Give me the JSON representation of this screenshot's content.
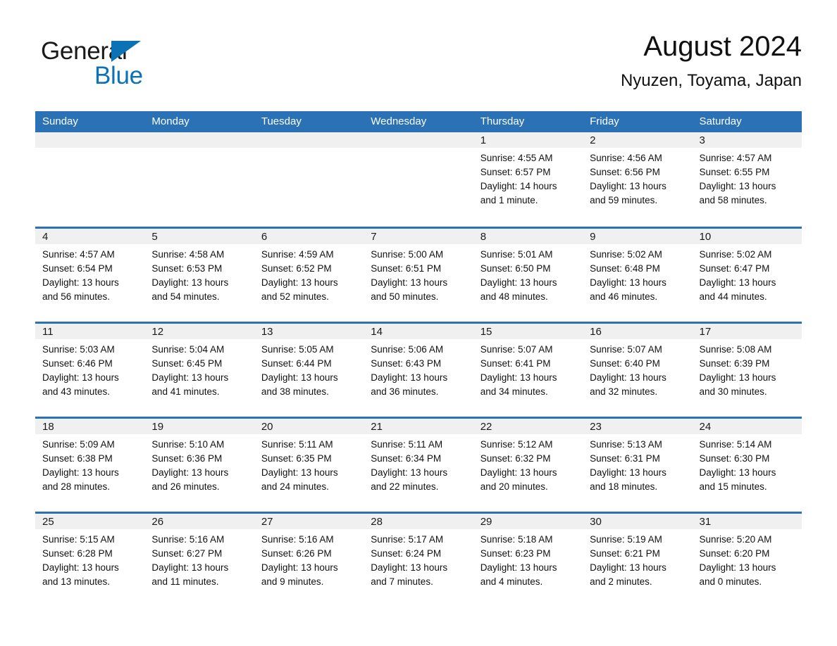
{
  "brand": {
    "word_one": "General",
    "word_two": "Blue",
    "accent_color": "#0b72b5",
    "triangle_icon": "brand-triangle-icon"
  },
  "header": {
    "title": "August 2024",
    "location": "Nyuzen, Toyama, Japan"
  },
  "theme": {
    "header_blue": "#2a72b5",
    "date_band_gray": "#f0f0f0",
    "text_color": "#111111"
  },
  "weekday_headers": [
    "Sunday",
    "Monday",
    "Tuesday",
    "Wednesday",
    "Thursday",
    "Friday",
    "Saturday"
  ],
  "labels": {
    "sunrise_prefix": "Sunrise:",
    "sunset_prefix": "Sunset:",
    "daylight_prefix": "Daylight:"
  },
  "weeks": [
    [
      {
        "date": "",
        "lines": [
          "",
          "",
          "",
          ""
        ]
      },
      {
        "date": "",
        "lines": [
          "",
          "",
          "",
          ""
        ]
      },
      {
        "date": "",
        "lines": [
          "",
          "",
          "",
          ""
        ]
      },
      {
        "date": "",
        "lines": [
          "",
          "",
          "",
          ""
        ]
      },
      {
        "date": "1",
        "lines": [
          "Sunrise: 4:55 AM",
          "Sunset: 6:57 PM",
          "Daylight: 14 hours",
          "and 1 minute."
        ]
      },
      {
        "date": "2",
        "lines": [
          "Sunrise: 4:56 AM",
          "Sunset: 6:56 PM",
          "Daylight: 13 hours",
          "and 59 minutes."
        ]
      },
      {
        "date": "3",
        "lines": [
          "Sunrise: 4:57 AM",
          "Sunset: 6:55 PM",
          "Daylight: 13 hours",
          "and 58 minutes."
        ]
      }
    ],
    [
      {
        "date": "4",
        "lines": [
          "Sunrise: 4:57 AM",
          "Sunset: 6:54 PM",
          "Daylight: 13 hours",
          "and 56 minutes."
        ]
      },
      {
        "date": "5",
        "lines": [
          "Sunrise: 4:58 AM",
          "Sunset: 6:53 PM",
          "Daylight: 13 hours",
          "and 54 minutes."
        ]
      },
      {
        "date": "6",
        "lines": [
          "Sunrise: 4:59 AM",
          "Sunset: 6:52 PM",
          "Daylight: 13 hours",
          "and 52 minutes."
        ]
      },
      {
        "date": "7",
        "lines": [
          "Sunrise: 5:00 AM",
          "Sunset: 6:51 PM",
          "Daylight: 13 hours",
          "and 50 minutes."
        ]
      },
      {
        "date": "8",
        "lines": [
          "Sunrise: 5:01 AM",
          "Sunset: 6:50 PM",
          "Daylight: 13 hours",
          "and 48 minutes."
        ]
      },
      {
        "date": "9",
        "lines": [
          "Sunrise: 5:02 AM",
          "Sunset: 6:48 PM",
          "Daylight: 13 hours",
          "and 46 minutes."
        ]
      },
      {
        "date": "10",
        "lines": [
          "Sunrise: 5:02 AM",
          "Sunset: 6:47 PM",
          "Daylight: 13 hours",
          "and 44 minutes."
        ]
      }
    ],
    [
      {
        "date": "11",
        "lines": [
          "Sunrise: 5:03 AM",
          "Sunset: 6:46 PM",
          "Daylight: 13 hours",
          "and 43 minutes."
        ]
      },
      {
        "date": "12",
        "lines": [
          "Sunrise: 5:04 AM",
          "Sunset: 6:45 PM",
          "Daylight: 13 hours",
          "and 41 minutes."
        ]
      },
      {
        "date": "13",
        "lines": [
          "Sunrise: 5:05 AM",
          "Sunset: 6:44 PM",
          "Daylight: 13 hours",
          "and 38 minutes."
        ]
      },
      {
        "date": "14",
        "lines": [
          "Sunrise: 5:06 AM",
          "Sunset: 6:43 PM",
          "Daylight: 13 hours",
          "and 36 minutes."
        ]
      },
      {
        "date": "15",
        "lines": [
          "Sunrise: 5:07 AM",
          "Sunset: 6:41 PM",
          "Daylight: 13 hours",
          "and 34 minutes."
        ]
      },
      {
        "date": "16",
        "lines": [
          "Sunrise: 5:07 AM",
          "Sunset: 6:40 PM",
          "Daylight: 13 hours",
          "and 32 minutes."
        ]
      },
      {
        "date": "17",
        "lines": [
          "Sunrise: 5:08 AM",
          "Sunset: 6:39 PM",
          "Daylight: 13 hours",
          "and 30 minutes."
        ]
      }
    ],
    [
      {
        "date": "18",
        "lines": [
          "Sunrise: 5:09 AM",
          "Sunset: 6:38 PM",
          "Daylight: 13 hours",
          "and 28 minutes."
        ]
      },
      {
        "date": "19",
        "lines": [
          "Sunrise: 5:10 AM",
          "Sunset: 6:36 PM",
          "Daylight: 13 hours",
          "and 26 minutes."
        ]
      },
      {
        "date": "20",
        "lines": [
          "Sunrise: 5:11 AM",
          "Sunset: 6:35 PM",
          "Daylight: 13 hours",
          "and 24 minutes."
        ]
      },
      {
        "date": "21",
        "lines": [
          "Sunrise: 5:11 AM",
          "Sunset: 6:34 PM",
          "Daylight: 13 hours",
          "and 22 minutes."
        ]
      },
      {
        "date": "22",
        "lines": [
          "Sunrise: 5:12 AM",
          "Sunset: 6:32 PM",
          "Daylight: 13 hours",
          "and 20 minutes."
        ]
      },
      {
        "date": "23",
        "lines": [
          "Sunrise: 5:13 AM",
          "Sunset: 6:31 PM",
          "Daylight: 13 hours",
          "and 18 minutes."
        ]
      },
      {
        "date": "24",
        "lines": [
          "Sunrise: 5:14 AM",
          "Sunset: 6:30 PM",
          "Daylight: 13 hours",
          "and 15 minutes."
        ]
      }
    ],
    [
      {
        "date": "25",
        "lines": [
          "Sunrise: 5:15 AM",
          "Sunset: 6:28 PM",
          "Daylight: 13 hours",
          "and 13 minutes."
        ]
      },
      {
        "date": "26",
        "lines": [
          "Sunrise: 5:16 AM",
          "Sunset: 6:27 PM",
          "Daylight: 13 hours",
          "and 11 minutes."
        ]
      },
      {
        "date": "27",
        "lines": [
          "Sunrise: 5:16 AM",
          "Sunset: 6:26 PM",
          "Daylight: 13 hours",
          "and 9 minutes."
        ]
      },
      {
        "date": "28",
        "lines": [
          "Sunrise: 5:17 AM",
          "Sunset: 6:24 PM",
          "Daylight: 13 hours",
          "and 7 minutes."
        ]
      },
      {
        "date": "29",
        "lines": [
          "Sunrise: 5:18 AM",
          "Sunset: 6:23 PM",
          "Daylight: 13 hours",
          "and 4 minutes."
        ]
      },
      {
        "date": "30",
        "lines": [
          "Sunrise: 5:19 AM",
          "Sunset: 6:21 PM",
          "Daylight: 13 hours",
          "and 2 minutes."
        ]
      },
      {
        "date": "31",
        "lines": [
          "Sunrise: 5:20 AM",
          "Sunset: 6:20 PM",
          "Daylight: 13 hours",
          "and 0 minutes."
        ]
      }
    ]
  ]
}
